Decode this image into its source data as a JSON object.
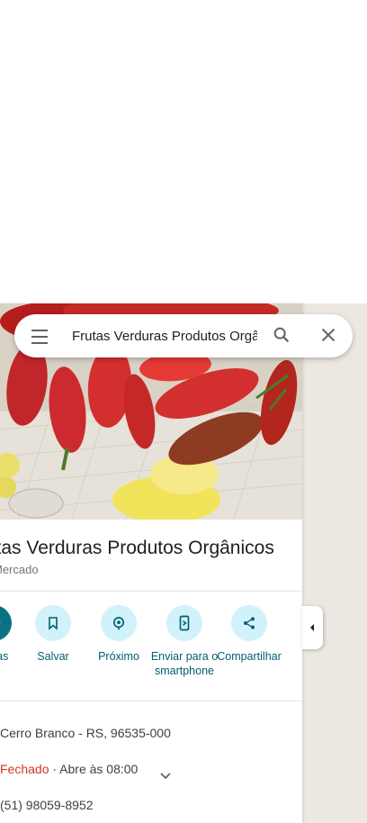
{
  "search": {
    "value": "Frutas Verduras Produtos Orgânicos",
    "menu_icon": "menu-icon",
    "search_icon": "search-icon",
    "close_icon": "close-icon"
  },
  "place": {
    "title": "Frutas Verduras Produtos Orgânicos",
    "subtitle": "Mercado"
  },
  "actions": [
    {
      "label": "Rotas",
      "icon": "directions-icon"
    },
    {
      "label": "Salvar",
      "icon": "bookmark-icon"
    },
    {
      "label": "Próximo",
      "icon": "nearby-icon"
    },
    {
      "label": "Enviar para o smartphone",
      "icon": "send-to-phone-icon"
    },
    {
      "label": "Compartilhar",
      "icon": "share-icon"
    }
  ],
  "info": {
    "address": "Cerro Branco - RS, 96535-000",
    "status": "Fechado",
    "hours": "· Abre às 08:00",
    "phone": "(51) 98059-8952"
  },
  "colors": {
    "accent": "#00606e",
    "action_bg": "#d2f2fb",
    "closed": "#d93025"
  }
}
